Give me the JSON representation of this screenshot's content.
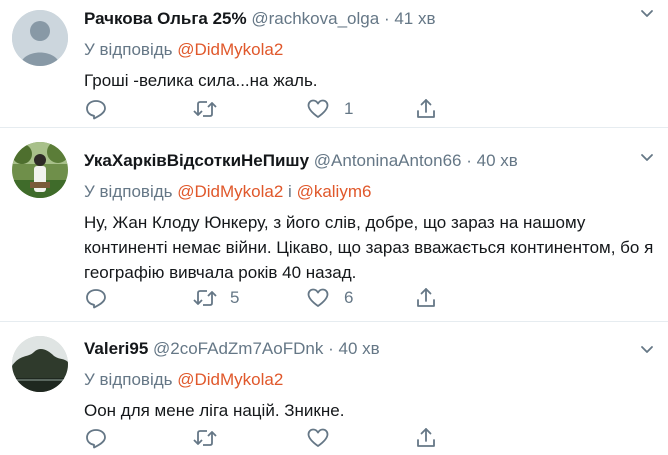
{
  "tweets": [
    {
      "name": "Рачкова Ольга 25%",
      "handle": "@rachkova_olga",
      "dot": "·",
      "time": "41 хв",
      "reply_prefix": "У відповідь",
      "reply_to_1": "@DidMykola2",
      "reply_and": "",
      "reply_to_2": "",
      "text": "Гроші -велика сила...на жаль.",
      "actions": {
        "reply_count": "",
        "retweet_count": "",
        "like_count": "1"
      },
      "avatar_icon": "default-user-avatar"
    },
    {
      "name": "УкаХарківВідсоткиНеПишу",
      "handle": "@AntoninaAnton66",
      "dot": "·",
      "time": "40 хв",
      "reply_prefix": "У відповідь",
      "reply_to_1": "@DidMykola2",
      "reply_and": "і",
      "reply_to_2": "@kaliym6",
      "text": "Ну, Жан Клоду Юнкеру, з його слів, добре, що зараз на нашому континенті немає війни. Цікаво, що зараз вважається континентом, бо я географію вивчала років 40 назад.",
      "actions": {
        "reply_count": "",
        "retweet_count": "5",
        "like_count": "6"
      },
      "avatar_icon": "photo-avatar-person-in-garden"
    },
    {
      "name": "Valeri95",
      "handle": "@2coFAdZm7AoFDnk",
      "dot": "·",
      "time": "40 хв",
      "reply_prefix": "У відповідь",
      "reply_to_1": "@DidMykola2",
      "reply_and": "",
      "reply_to_2": "",
      "text": "Оон для мене ліга націй. Зникне.",
      "actions": {
        "reply_count": "",
        "retweet_count": "",
        "like_count": ""
      },
      "avatar_icon": "photo-avatar-landscape"
    }
  ],
  "colors": {
    "link": "#e0582b",
    "secondary_text": "#657786",
    "primary_text": "#14171a",
    "divider": "#e6ecf0"
  }
}
